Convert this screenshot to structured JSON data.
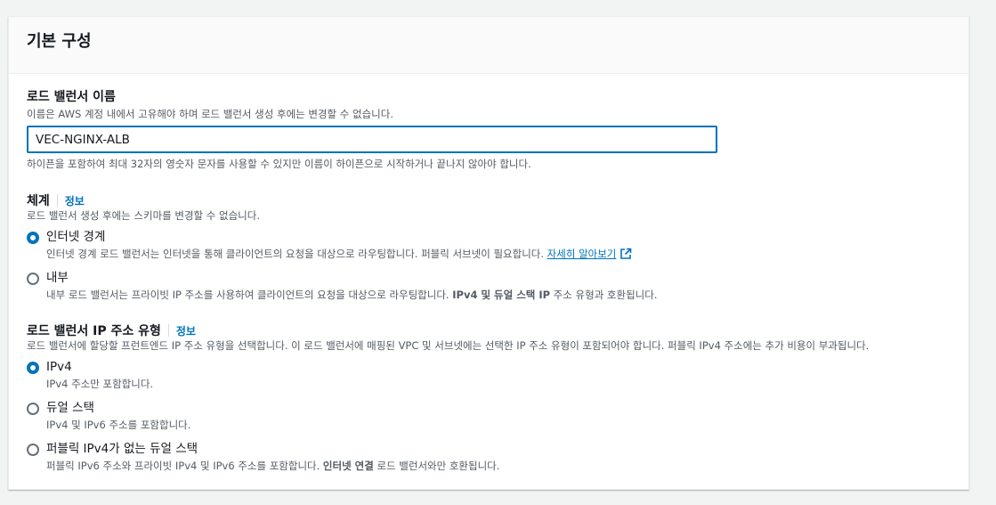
{
  "section": {
    "title": "기본 구성"
  },
  "lb_name": {
    "label": "로드 밸런서 이름",
    "description": "이름은 AWS 계정 내에서 고유해야 하며 로드 밸런서 생성 후에는 변경할 수 없습니다.",
    "value": "VEC-NGINX-ALB",
    "constraint": "하이픈을 포함하여 최대 32자의 영숫자 문자를 사용할 수 있지만 이름이 하이픈으로 시작하거나 끝나지 않아야 합니다."
  },
  "scheme": {
    "label": "체계",
    "info": "정보",
    "description": "로드 밸런서 생성 후에는 스키마를 변경할 수 없습니다.",
    "options": [
      {
        "label": "인터넷 경계",
        "desc": "인터넷 경계 로드 밸런서는 인터넷을 통해 클라이언트의 요청을 대상으로 라우팅합니다. 퍼블릭 서브넷이 필요합니다.",
        "link": "자세히 알아보기",
        "checked": true
      },
      {
        "label": "내부",
        "desc_pre": "내부 로드 밸런서는 프라이빗 IP 주소를 사용하여 클라이언트의 요청을 대상으로 라우팅합니다. ",
        "desc_bold": "IPv4 및 듀얼 스택 IP",
        "desc_post": " 주소 유형과 호환됩니다.",
        "checked": false
      }
    ]
  },
  "ip_type": {
    "label": "로드 밸런서 IP 주소 유형",
    "info": "정보",
    "description": "로드 밸런서에 할당할 프런트엔드 IP 주소 유형을 선택합니다. 이 로드 밸런서에 매핑된 VPC 및 서브넷에는 선택한 IP 주소 유형이 포함되어야 합니다. 퍼블릭 IPv4 주소에는 추가 비용이 부과됩니다.",
    "options": [
      {
        "label": "IPv4",
        "desc": "IPv4 주소만 포함합니다.",
        "checked": true
      },
      {
        "label": "듀얼 스택",
        "desc": "IPv4 및 IPv6 주소를 포함합니다.",
        "checked": false
      },
      {
        "label": "퍼블릭 IPv4가 없는 듀얼 스택",
        "desc_pre": "퍼블릭 IPv6 주소와 프라이빗 IPv4 및 IPv6 주소를 포함합니다. ",
        "desc_bold": "인터넷 연결",
        "desc_post": " 로드 밸런서와만 호환됩니다.",
        "checked": false
      }
    ]
  },
  "colors": {
    "accent": "#0073bb",
    "text": "#16191f",
    "secondary_text": "#545b64"
  },
  "icons": {
    "external_link": "external-link-icon"
  }
}
